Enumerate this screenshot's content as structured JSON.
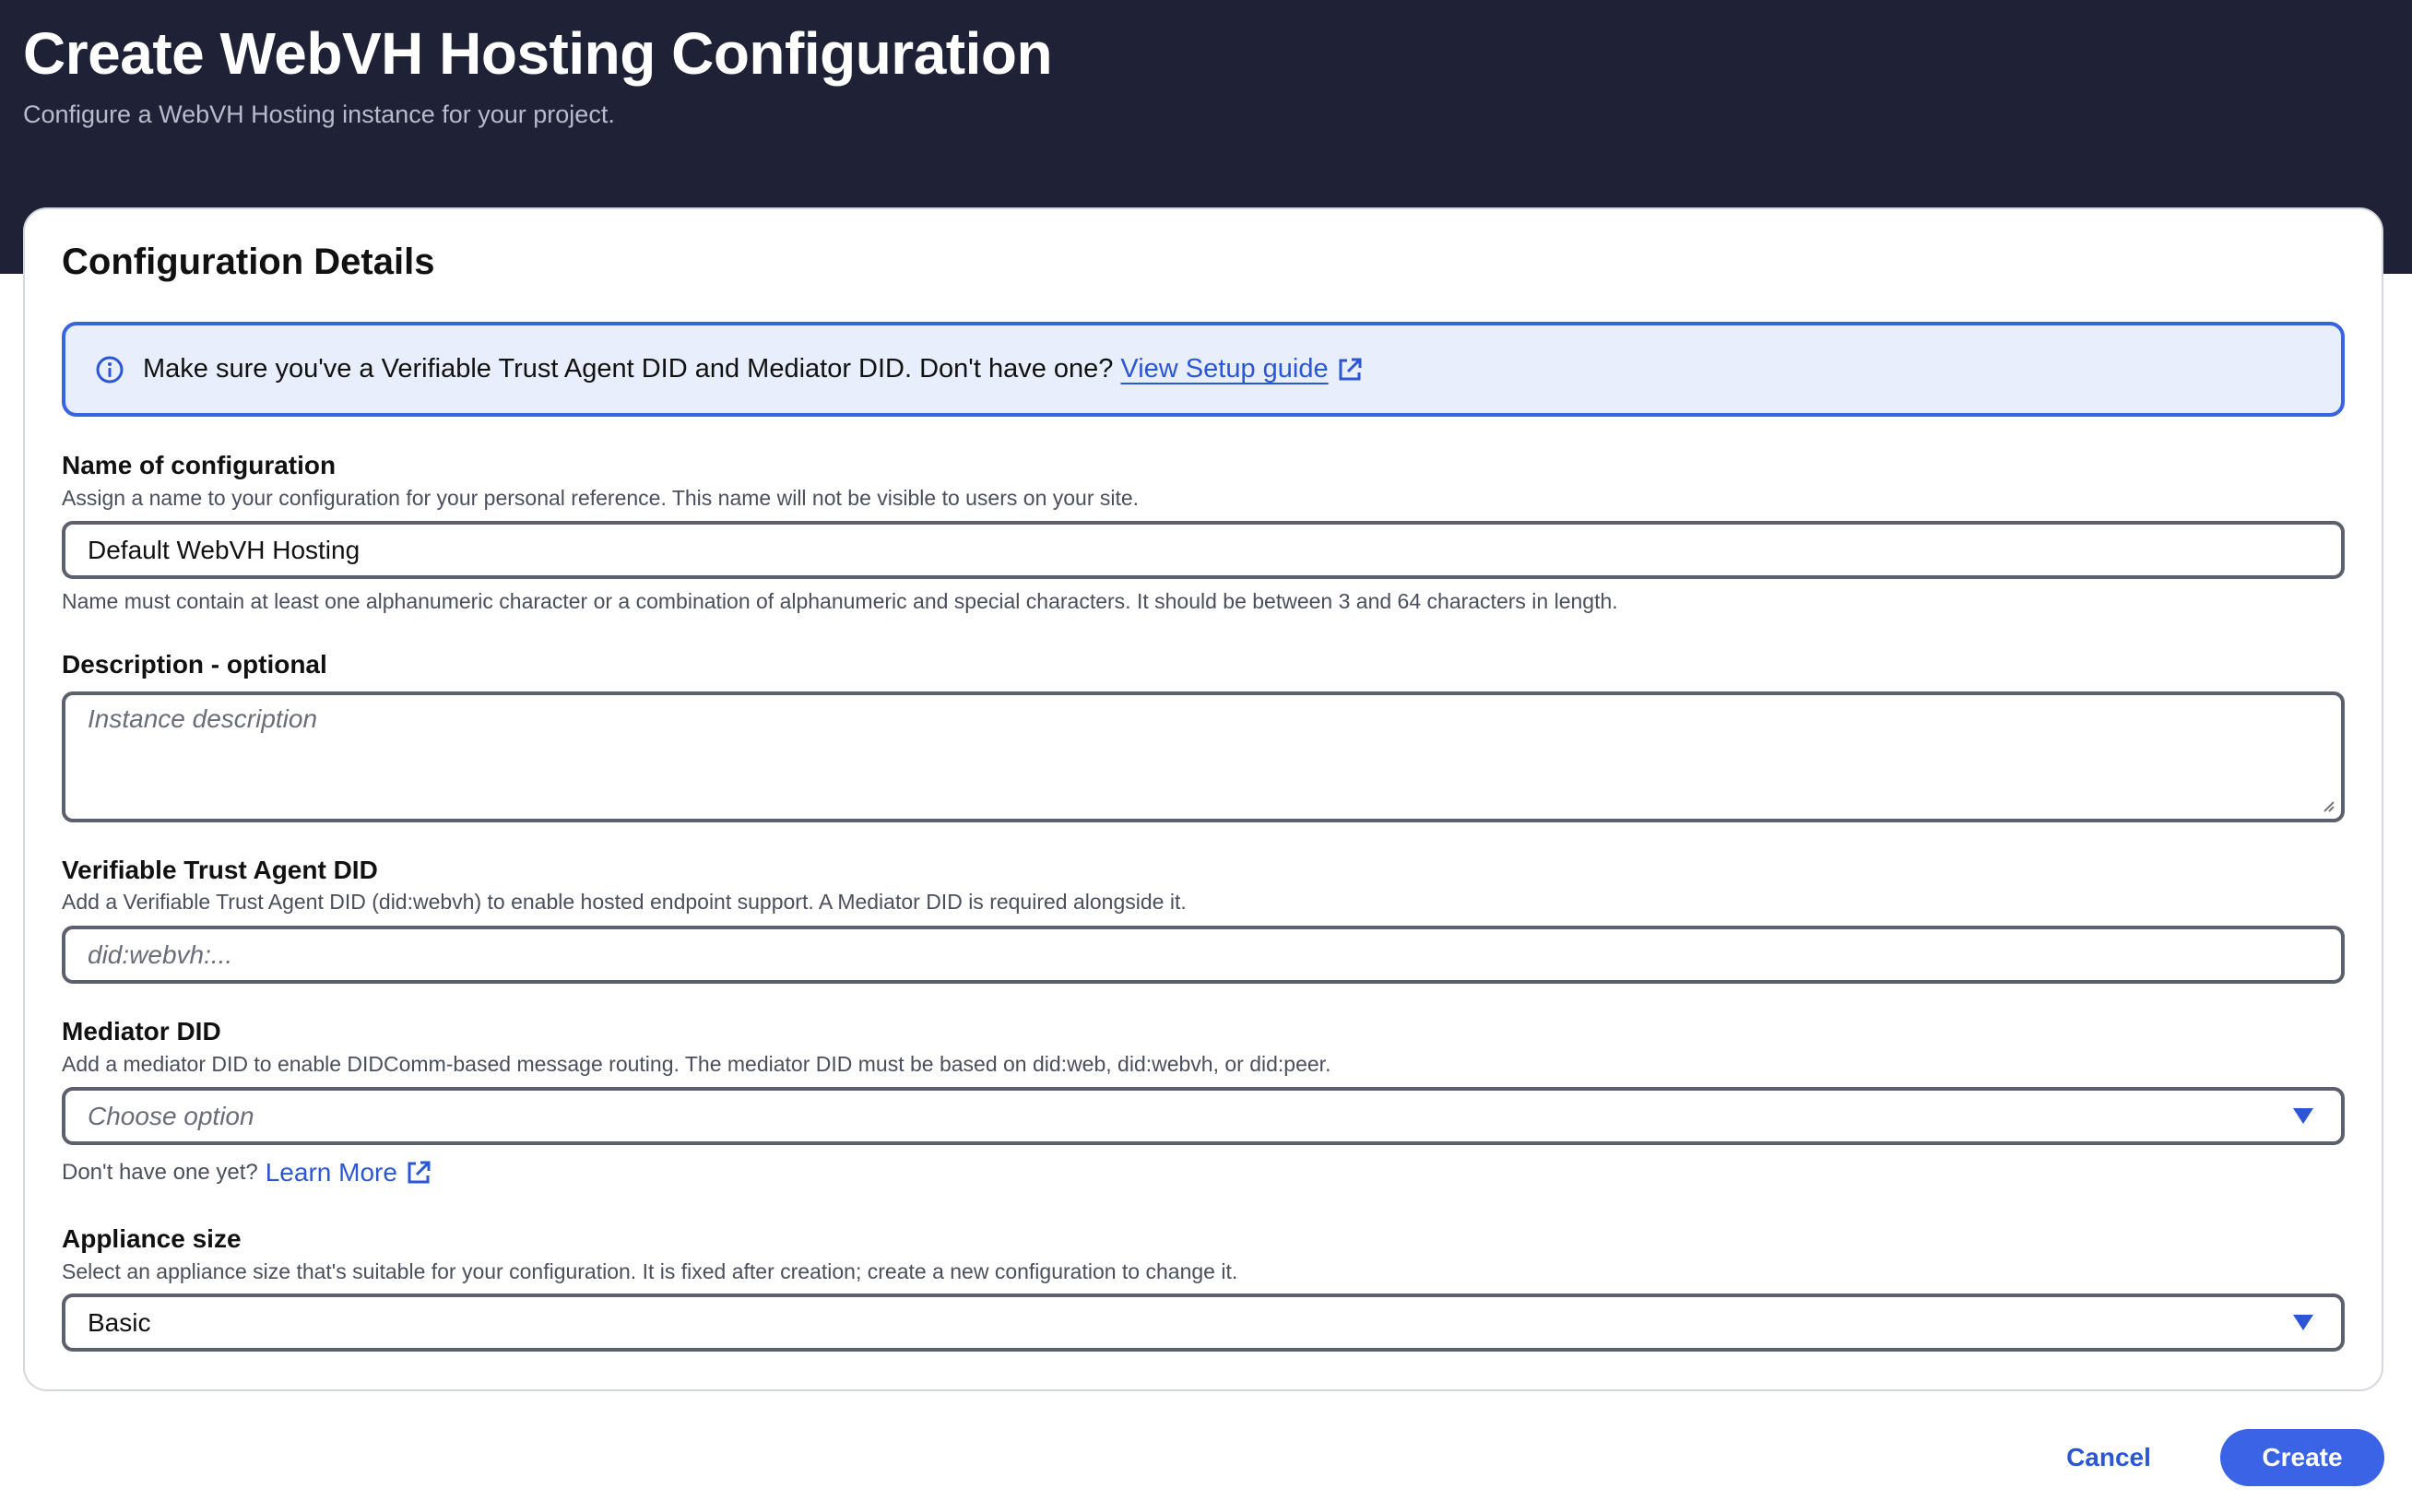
{
  "header": {
    "title": "Create WebVH Hosting Configuration",
    "subtitle": "Configure a WebVH Hosting instance for your project."
  },
  "card": {
    "title": "Configuration Details",
    "info_banner": {
      "text": "Make sure you've a Verifiable Trust Agent DID and Mediator DID. Don't have one?",
      "link_label": "View Setup guide",
      "icon": "info-icon",
      "link_icon": "external-link-icon"
    }
  },
  "fields": {
    "name": {
      "label": "Name of configuration",
      "help": "Assign a name to your configuration for your personal reference. This name will not be visible to users on your site.",
      "value": "Default WebVH Hosting",
      "hint": "Name must contain at least one alphanumeric character or a combination of alphanumeric and special characters. It should be between 3 and 64 characters in length."
    },
    "description": {
      "label": "Description - optional",
      "placeholder": "Instance description"
    },
    "trust_agent": {
      "label": "Verifiable Trust Agent DID",
      "help": "Add a Verifiable Trust Agent DID (did:webvh) to enable hosted endpoint support. A Mediator DID is required alongside it.",
      "placeholder": "did:webvh:..."
    },
    "mediator": {
      "label": "Mediator DID",
      "help": "Add a mediator DID to enable DIDComm-based message routing. The mediator DID must be based on did:web, did:webvh, or did:peer.",
      "placeholder": "Choose option",
      "footer_text": "Don't have one yet?",
      "footer_link": "Learn More"
    },
    "appliance": {
      "label": "Appliance size",
      "help": "Select an appliance size that's suitable for your configuration. It is fixed after creation; create a new configuration to change it.",
      "value": "Basic"
    }
  },
  "actions": {
    "cancel_label": "Cancel",
    "create_label": "Create"
  },
  "colors": {
    "header_bg": "#1f2236",
    "accent": "#3b63e6",
    "banner_bg": "#e8eefb",
    "banner_border": "#3a63df"
  }
}
